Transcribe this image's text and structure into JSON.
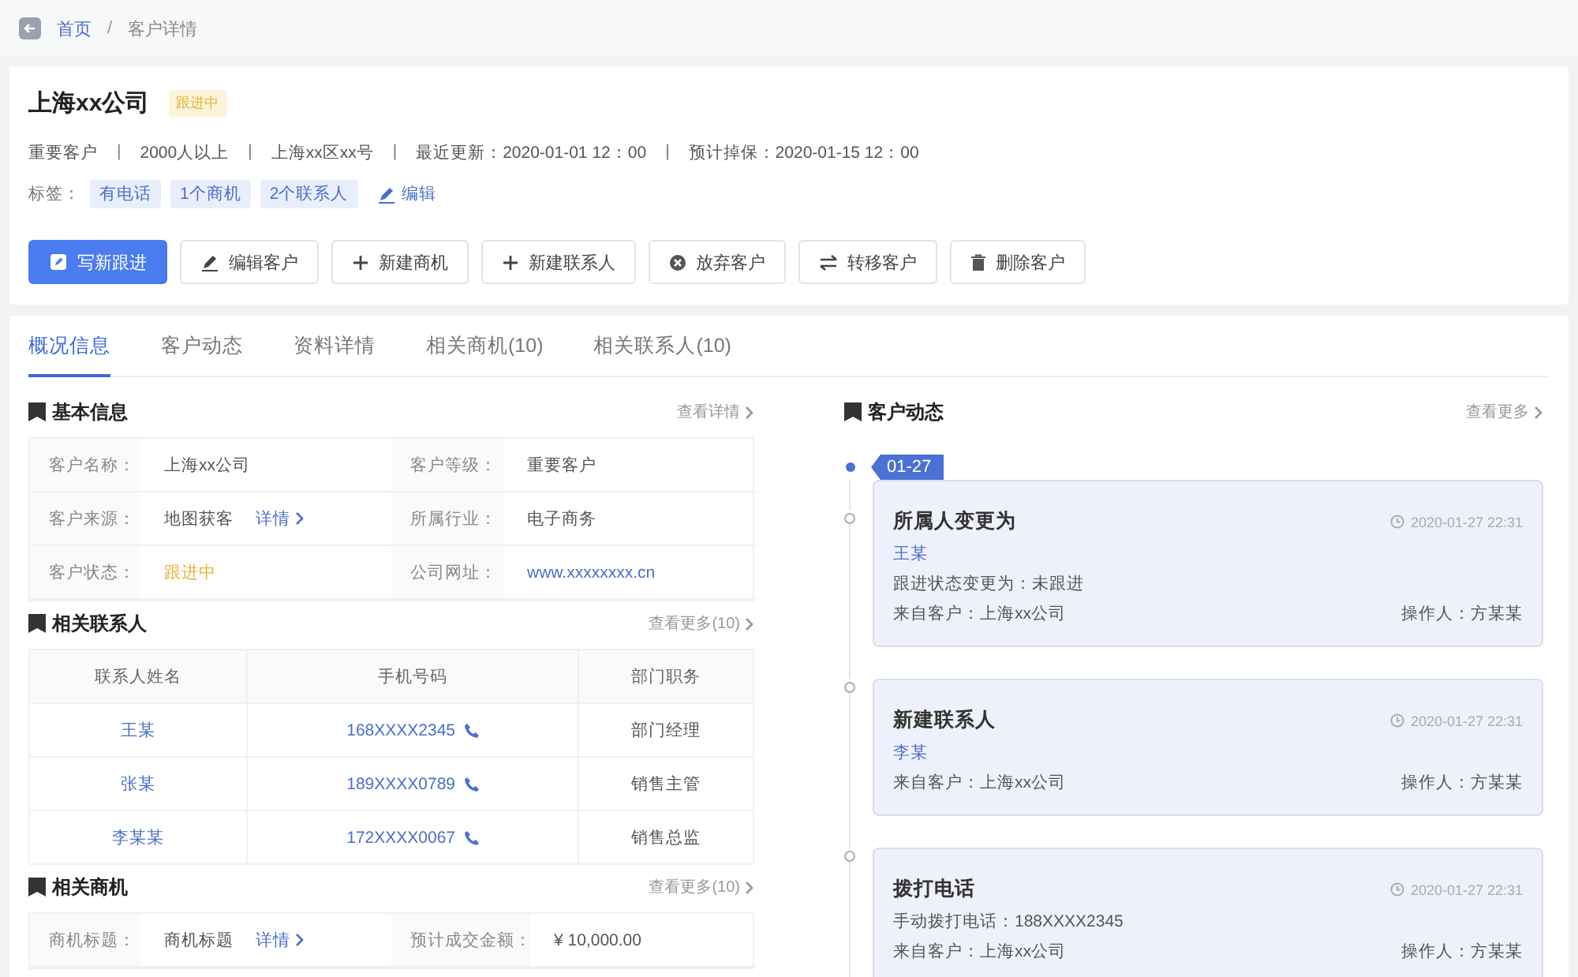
{
  "breadcrumb": {
    "items": [
      {
        "label": "首页",
        "kind": "link"
      },
      {
        "label": "客户详情",
        "kind": "current"
      }
    ],
    "separator": "/"
  },
  "customer": {
    "name": "上海xx公司",
    "status_badge": "跟进中",
    "meta_separator": "|",
    "meta": [
      "重要客户",
      "2000人以上",
      "上海xx区xx号",
      "最近更新：2020-01-01  12：00",
      "预计掉保：2020-01-15 12：00"
    ],
    "tags_label": "标签：",
    "tags": [
      "有电话",
      "1个商机",
      "2个联系人"
    ],
    "edit_tags": "编辑"
  },
  "actions": [
    {
      "label": "写新跟进",
      "kind": "followup"
    },
    {
      "label": "编辑客户",
      "kind": "edit"
    },
    {
      "label": "新建商机",
      "kind": "create"
    },
    {
      "label": "新建联系人",
      "kind": "create"
    },
    {
      "label": "放弃客户",
      "kind": "abandon"
    },
    {
      "label": "转移客户",
      "kind": "transfer"
    },
    {
      "label": "删除客户",
      "kind": "delete"
    }
  ],
  "tabs": [
    {
      "label": "概况信息",
      "selected": true
    },
    {
      "label": "客户动态",
      "selected": false
    },
    {
      "label": "资料详情",
      "selected": false
    },
    {
      "label": "相关商机(10)",
      "selected": false
    },
    {
      "label": "相关联系人(10)",
      "selected": false
    }
  ],
  "basic_info": {
    "title": "基本信息",
    "more": "查看详情",
    "fields": [
      {
        "label": "客户名称：",
        "value": "上海xx公司",
        "kind": "text"
      },
      {
        "label": "客户等级：",
        "value": "重要客户",
        "kind": "text"
      },
      {
        "label": "客户来源：",
        "value": "地图获客",
        "kind": "text",
        "link": "详情"
      },
      {
        "label": "所属行业：",
        "value": "电子商务",
        "kind": "text"
      },
      {
        "label": "客户状态：",
        "value": "跟进中",
        "kind": "status"
      },
      {
        "label": "公司网址：",
        "value": "www.xxxxxxxx.cn",
        "kind": "url"
      }
    ]
  },
  "contacts": {
    "title": "相关联系人",
    "more": "查看更多(10)",
    "columns": [
      "联系人姓名",
      "手机号码",
      "部门职务"
    ],
    "rows": [
      {
        "name": "王某",
        "phone": "168XXXX2345",
        "role": "部门经理"
      },
      {
        "name": "张某",
        "phone": "189XXXX0789",
        "role": "销售主管"
      },
      {
        "name": "李某某",
        "phone": "172XXXX0067",
        "role": "销售总监"
      }
    ]
  },
  "opportunities": {
    "title": "相关商机",
    "more": "查看更多(10)",
    "fields": [
      {
        "label": "商机标题：",
        "value": "商机标题",
        "link": "详情"
      },
      {
        "label": "预计成交金额：",
        "value": "¥ 10,000.00"
      }
    ]
  },
  "activity": {
    "title": "客户动态",
    "more": "查看更多",
    "date": "01-27",
    "events": [
      {
        "title": "所属人变更为",
        "time": "2020-01-27  22:31",
        "lines": [
          {
            "text": "王某",
            "kind": "link"
          },
          {
            "text": "跟进状态变更为：未跟进",
            "kind": "text"
          }
        ],
        "source": "来自客户：上海xx公司",
        "operator": "操作人：方某某"
      },
      {
        "title": "新建联系人",
        "time": "2020-01-27  22:31",
        "lines": [
          {
            "text": "李某",
            "kind": "link"
          }
        ],
        "source": "来自客户：上海xx公司",
        "operator": "操作人：方某某"
      },
      {
        "title": "拨打电话",
        "time": "2020-01-27  22:31",
        "lines": [
          {
            "text": "手动拨打电话：188XXXX2345",
            "kind": "text"
          }
        ],
        "source": "来自客户：上海xx公司",
        "operator": "操作人：方某某"
      }
    ]
  }
}
